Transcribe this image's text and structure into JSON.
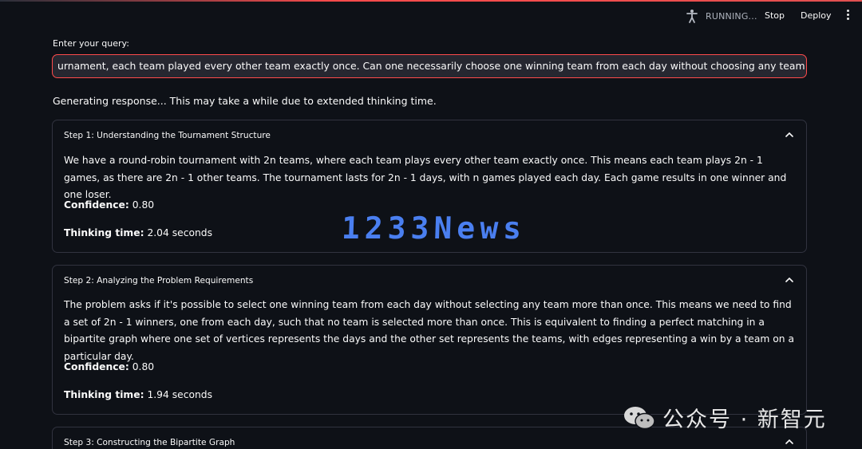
{
  "header": {
    "status": "RUNNING...",
    "stop_label": "Stop",
    "deploy_label": "Deploy"
  },
  "query": {
    "label": "Enter your query:",
    "value": "urnament, each team played every other team exactly once. Can one necessarily choose one winning team from each day without choosing any team more than once?"
  },
  "status_text": "Generating response... This may take a while due to extended thinking time.",
  "steps": [
    {
      "title": "Step 1: Understanding the Tournament Structure",
      "body": "We have a round-robin tournament with 2n teams, where each team plays every other team exactly once. This means each team plays 2n - 1 games, as there are 2n - 1 other teams. The tournament lasts for 2n - 1 days, with n games played each day. Each game results in one winner and one loser.",
      "confidence_label": "Confidence:",
      "confidence_value": "0.80",
      "time_label": "Thinking time:",
      "time_value": "2.04 seconds"
    },
    {
      "title": "Step 2: Analyzing the Problem Requirements",
      "body": "The problem asks if it's possible to select one winning team from each day without selecting any team more than once. This means we need to find a set of 2n - 1 winners, one from each day, such that no team is selected more than once. This is equivalent to finding a perfect matching in a bipartite graph where one set of vertices represents the days and the other set represents the teams, with edges representing a win by a team on a particular day.",
      "confidence_label": "Confidence:",
      "confidence_value": "0.80",
      "time_label": "Thinking time:",
      "time_value": "1.94 seconds"
    },
    {
      "title": "Step 3: Constructing the Bipartite Graph"
    }
  ],
  "watermark": "1233News",
  "brand": "公众号 · 新智元",
  "colors": {
    "background": "#0e1117",
    "input_bg": "#262730",
    "accent": "#ff4b4b",
    "border": "#31333f",
    "watermark": "#4a7ff0"
  },
  "icons": {
    "running": "running-person-icon",
    "menu": "more-vertical-icon",
    "expander": "chevron-up-icon",
    "brand": "wechat-icon"
  }
}
